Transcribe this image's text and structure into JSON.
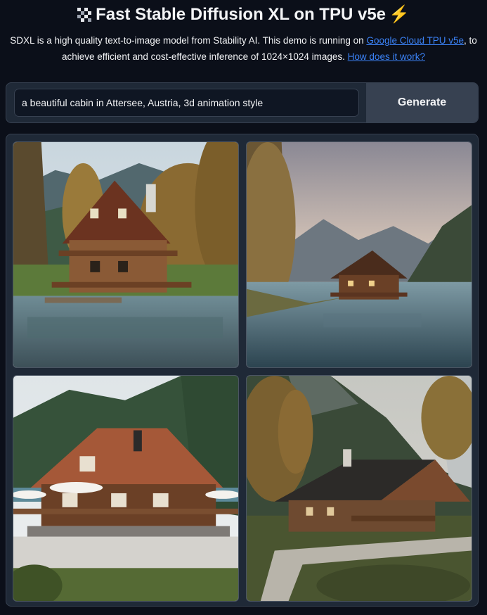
{
  "header": {
    "title": "Fast Stable Diffusion XL on TPU v5e",
    "logo_icon": "pixel-logo-icon",
    "bolt_icon": "lightning-bolt-icon"
  },
  "description": {
    "text_1": "SDXL is a high quality text-to-image model from Stability AI. This demo is running on ",
    "link_1": "Google Cloud TPU v5e",
    "text_2": ", to achieve efficient and cost-effective inference of 1024×1024 images. ",
    "link_2": "How does it work?"
  },
  "prompt": {
    "value": "a beautiful cabin in Attersee, Austria, 3d animation style"
  },
  "generate_button": {
    "label": "Generate"
  },
  "gallery": {
    "share_icon": "share-icon",
    "images": [
      "cabin-image-1",
      "cabin-image-2",
      "cabin-image-3",
      "cabin-image-4"
    ]
  },
  "colors": {
    "background": "#0b0f19",
    "panel": "#1f2937",
    "link": "#3b82f6",
    "bolt": "#facc15"
  }
}
